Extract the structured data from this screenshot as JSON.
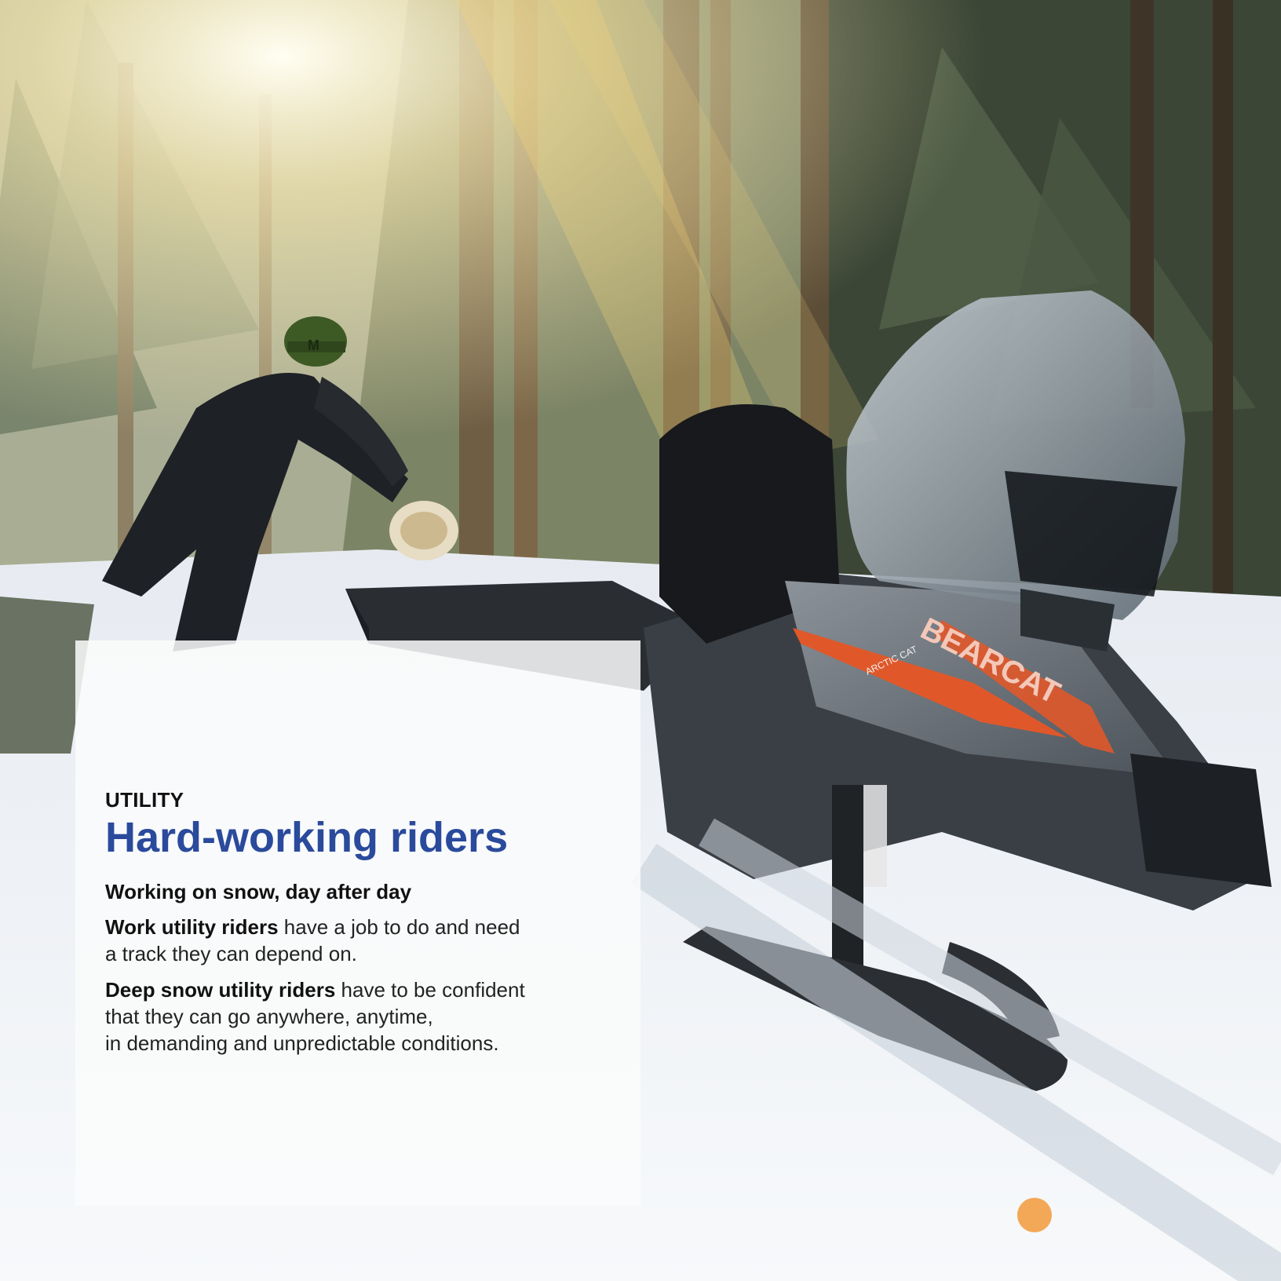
{
  "card": {
    "eyebrow": "UTILITY",
    "headline": "Hard-working riders",
    "subhead": "Working on snow, day after day",
    "paragraph1": {
      "bold": "Work utility riders",
      "rest": " have a job to do and need",
      "line2": "a track they can depend on."
    },
    "paragraph2": {
      "bold": "Deep snow utility riders",
      "rest": " have to be confident",
      "line2": "that they can go anywhere, anytime,",
      "line3": "in demanding and unpredictable conditions."
    }
  },
  "photo": {
    "sled_brand_text": "BEARCAT",
    "sled_logo_text": "ARCTIC CAT",
    "hat_text": "M"
  },
  "colors": {
    "headline": "#2a4a9c",
    "card_bg": "#fafbfc",
    "sled_accent": "#e0582a"
  }
}
